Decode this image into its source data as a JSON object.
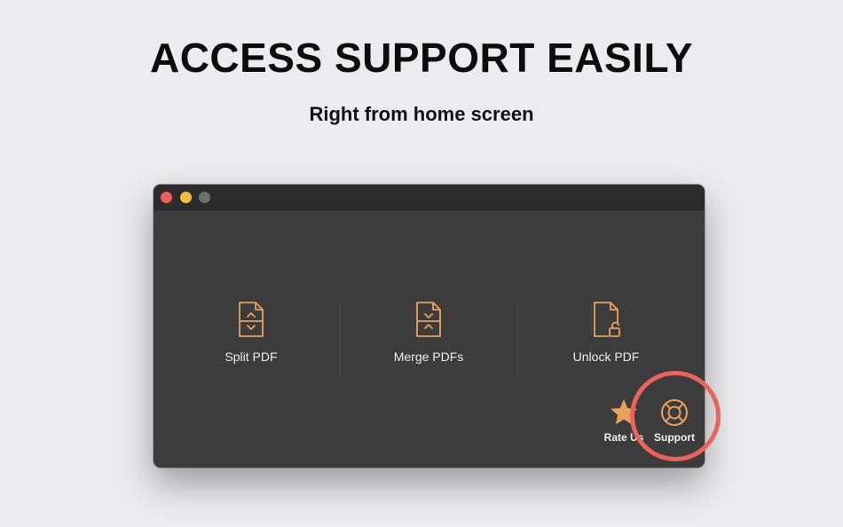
{
  "headline": "ACCESS SUPPORT EASILY",
  "subheadline": "Right from home screen",
  "colors": {
    "background": "#ececee",
    "window": "#3c3c3c",
    "titlebar": "#2b2b2b",
    "accent": "#e7a25e",
    "highlight": "#e9645a"
  },
  "window": {
    "traffic_lights": [
      "close",
      "minimize",
      "zoom"
    ],
    "tools": [
      {
        "label": "Split PDF",
        "icon": "split-document-icon"
      },
      {
        "label": "Merge PDFs",
        "icon": "merge-document-icon"
      },
      {
        "label": "Unlock PDF",
        "icon": "unlock-document-icon"
      }
    ],
    "footer": {
      "rate_label": "Rate Us",
      "rate_icon": "star-icon",
      "support_label": "Support",
      "support_icon": "lifebuoy-icon"
    }
  }
}
